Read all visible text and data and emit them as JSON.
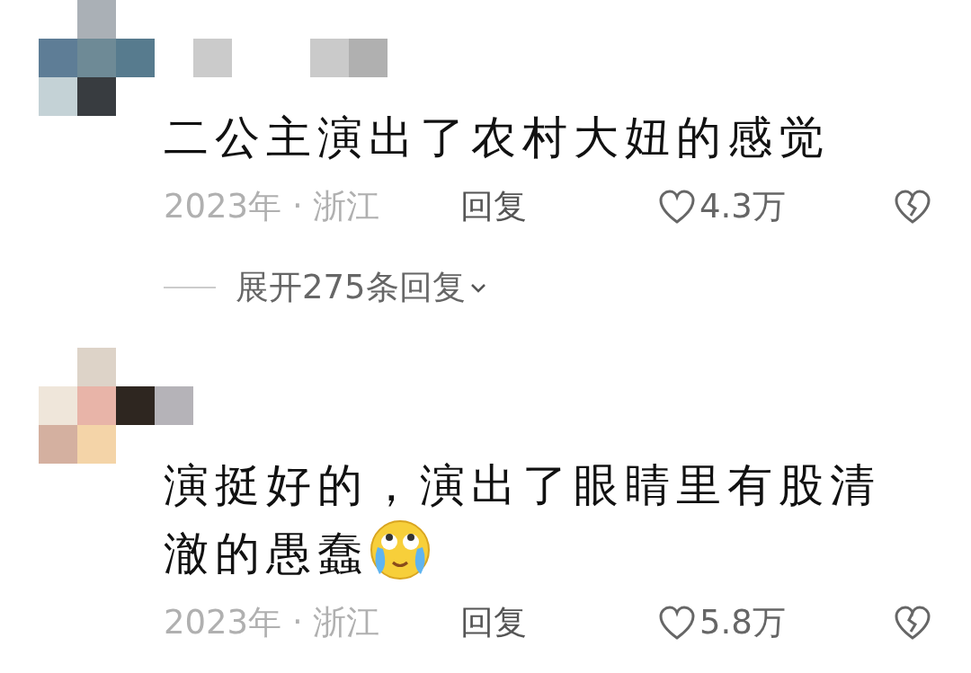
{
  "comments": [
    {
      "text": "二公主演出了农村大妞的感觉",
      "has_emoji": false,
      "date_location": "2023年 · 浙江",
      "reply": "回复",
      "likes": "4.3万",
      "expand": "展开275条回复"
    },
    {
      "text": "演挺好的，演出了眼睛里有股清澈的愚蠢",
      "has_emoji": true,
      "date_location": "2023年 · 浙江",
      "reply": "回复",
      "likes": "5.8万"
    }
  ]
}
